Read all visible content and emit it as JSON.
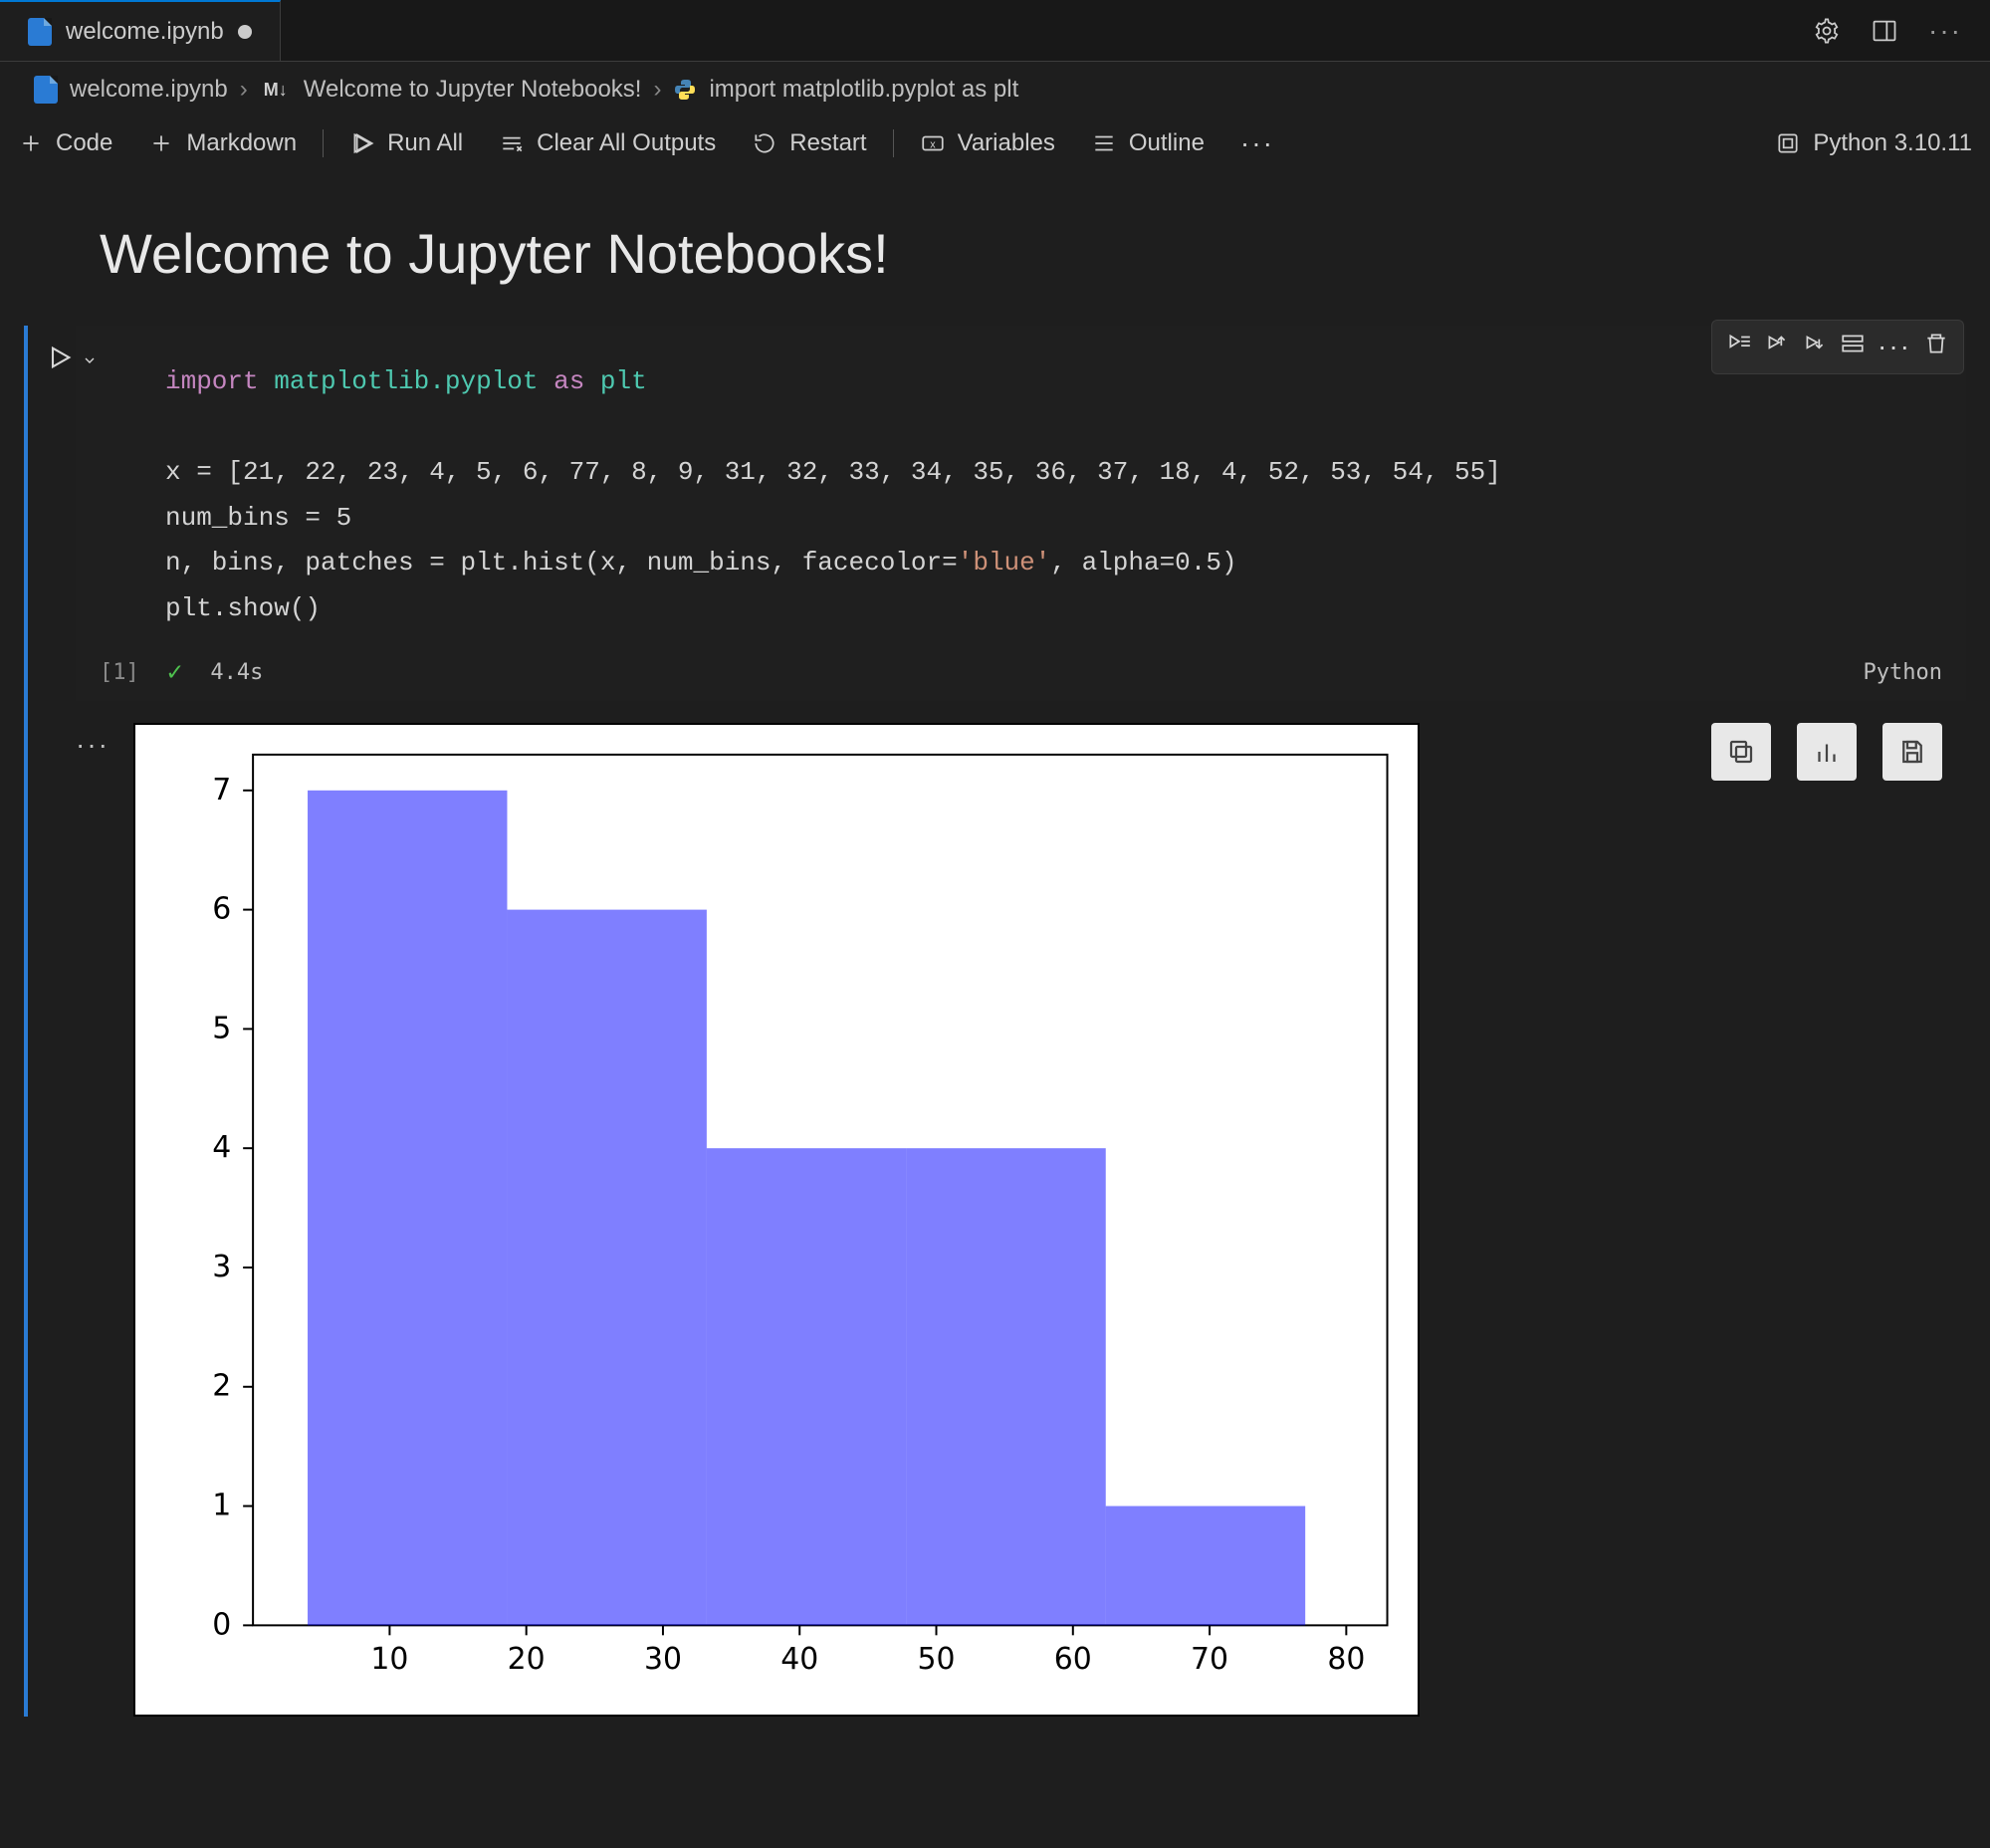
{
  "tab": {
    "filename": "welcome.ipynb",
    "dirty": true
  },
  "titlebar_actions": [
    "settings",
    "layout",
    "more"
  ],
  "breadcrumb": {
    "file": "welcome.ipynb",
    "section": "Welcome to Jupyter Notebooks!",
    "leaf": "import matplotlib.pyplot as plt"
  },
  "toolbar": {
    "code": "Code",
    "markdown": "Markdown",
    "run_all": "Run All",
    "clear_outputs": "Clear All Outputs",
    "restart": "Restart",
    "variables": "Variables",
    "outline": "Outline",
    "kernel": "Python 3.10.11"
  },
  "markdown_heading": "Welcome to Jupyter Notebooks!",
  "cell": {
    "execution_count": "[1]",
    "status_ok": true,
    "exec_time": "4.4s",
    "language": "Python",
    "code_display": {
      "line1_import": "import",
      "line1_pkg": "matplotlib.pyplot",
      "line1_as": "as",
      "line1_alias": "plt",
      "line3": "x = [21, 22, 23, 4, 5, 6, 77, 8, 9, 31, 32, 33, 34, 35, 36, 37, 18, 4, 52, 53, 54, 55]",
      "line4": "num_bins = 5",
      "line5_a": "n, bins, patches = plt.hist(x, num_bins, facecolor=",
      "line5_str": "'blue'",
      "line5_b": ", alpha=0.5)",
      "line6": "plt.show()"
    }
  },
  "output_actions": [
    "copy",
    "chart-view",
    "save"
  ],
  "chart_data": {
    "type": "histogram",
    "facecolor": "blue",
    "alpha": 0.5,
    "input_values": [
      21,
      22,
      23,
      4,
      5,
      6,
      77,
      8,
      9,
      31,
      32,
      33,
      34,
      35,
      36,
      37,
      18,
      4,
      52,
      53,
      54,
      55
    ],
    "num_bins": 5,
    "bin_edges": [
      4.0,
      18.6,
      33.2,
      47.8,
      62.4,
      77.0
    ],
    "counts": [
      7,
      6,
      4,
      4,
      1
    ],
    "x_ticks": [
      10,
      20,
      30,
      40,
      50,
      60,
      70,
      80
    ],
    "y_ticks": [
      0,
      1,
      2,
      3,
      4,
      5,
      6,
      7
    ],
    "xlim": [
      0,
      83
    ],
    "ylim": [
      0,
      7.3
    ]
  }
}
